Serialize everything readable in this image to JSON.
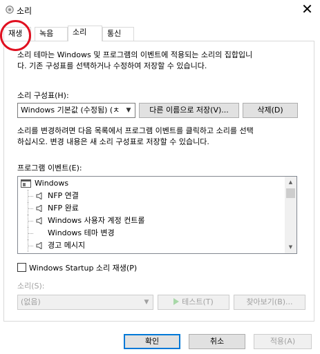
{
  "window": {
    "title": "소리",
    "close_glyph": "✕"
  },
  "tabs": [
    {
      "label": "재생"
    },
    {
      "label": "녹음"
    },
    {
      "label": "소리"
    },
    {
      "label": "통신"
    }
  ],
  "intro": "소리 테마는 Windows 및 프로그램의 이벤트에 적용되는 소리의 집합입니\n다. 기존 구성표를 선택하거나 수정하여 저장할 수 있습니다.",
  "scheme": {
    "label": "소리 구성표(H):",
    "value": "Windows 기본값 (수정됨) (ㅊ",
    "save_as": "다른 이름으로 저장(V)...",
    "delete": "삭제(D)"
  },
  "instructions": "소리를 변경하려면 다음 목록에서 프로그램 이벤트를 클릭하고 소리를 선택\n하십시오. 변경 내용은 새 소리 구성표로 저장할 수 있습니다.",
  "events": {
    "label": "프로그램 이벤트(E):",
    "items": [
      {
        "text": "Windows",
        "kind": "group",
        "icon": "window-icon"
      },
      {
        "text": "NFP 연결",
        "kind": "sound",
        "icon": "speaker-icon"
      },
      {
        "text": "NFP 완료",
        "kind": "sound",
        "icon": "speaker-icon"
      },
      {
        "text": "Windows 사용자 계정 컨트롤",
        "kind": "sound",
        "icon": "speaker-icon"
      },
      {
        "text": "Windows 테마 변경",
        "kind": "plain",
        "icon": ""
      },
      {
        "text": "경고 메시지",
        "kind": "sound",
        "icon": "speaker-icon"
      }
    ]
  },
  "startup": {
    "label": "Windows Startup 소리 재생(P)",
    "checked": false
  },
  "sound": {
    "label": "소리(S):",
    "value": "(없음)",
    "test": "테스트(T)",
    "browse": "찾아보기(B)..."
  },
  "footer": {
    "ok": "확인",
    "cancel": "취소",
    "apply": "적용(A)"
  },
  "colors": {
    "annotation": "#e01020",
    "primary_border": "#0078d7"
  }
}
